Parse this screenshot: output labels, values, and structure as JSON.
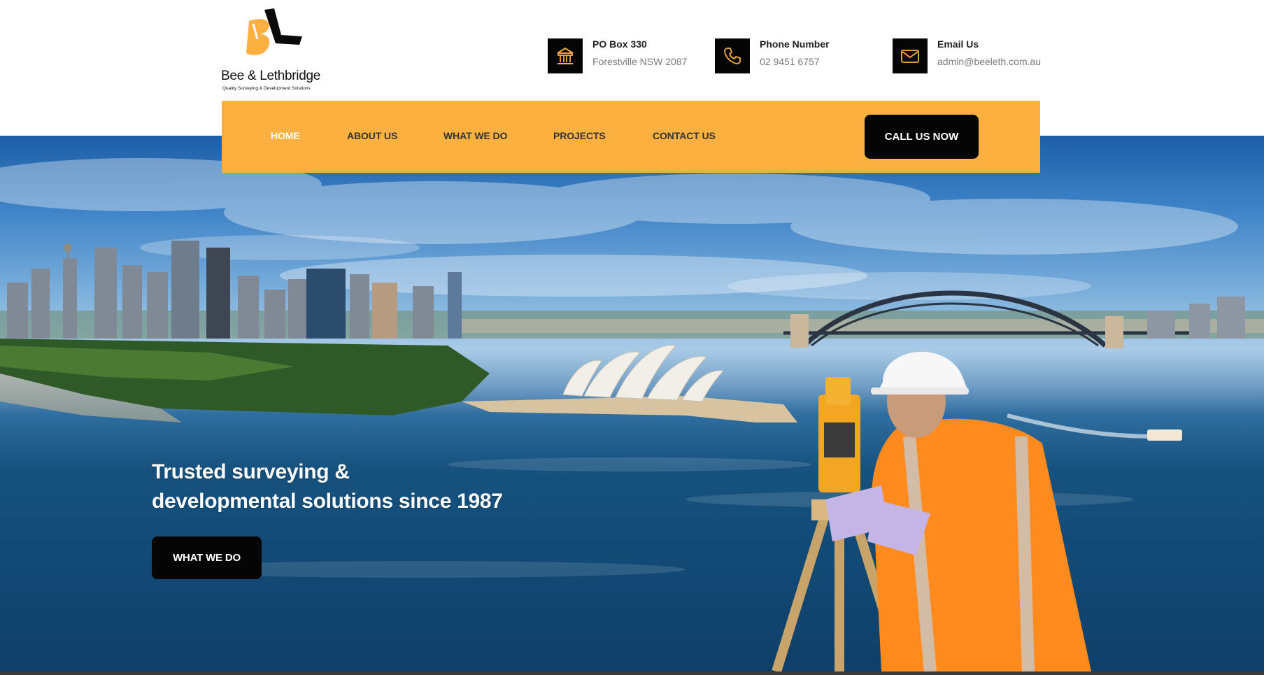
{
  "brand": {
    "name": "Bee & Lethbridge",
    "tagline": "Quality Surveying & Development Solutions",
    "accent_color": "#fbb040",
    "dark_color": "#050505"
  },
  "contacts": [
    {
      "icon": "building-icon",
      "title": "PO Box 330",
      "value": "Forestville NSW 2087"
    },
    {
      "icon": "phone-icon",
      "title": "Phone Number",
      "value": "02 9451 6757"
    },
    {
      "icon": "envelope-icon",
      "title": "Email Us",
      "value": "admin@beeleth.com.au"
    }
  ],
  "nav": {
    "items": [
      {
        "label": "HOME",
        "active": true
      },
      {
        "label": "ABOUT US",
        "active": false
      },
      {
        "label": "WHAT WE DO",
        "active": false
      },
      {
        "label": "PROJECTS",
        "active": false
      },
      {
        "label": "CONTACT US",
        "active": false
      }
    ],
    "cta_label": "CALL US NOW"
  },
  "hero": {
    "heading_line1": "Trusted surveying &",
    "heading_line2": "developmental solutions since 1987",
    "button_label": "WHAT WE DO"
  }
}
